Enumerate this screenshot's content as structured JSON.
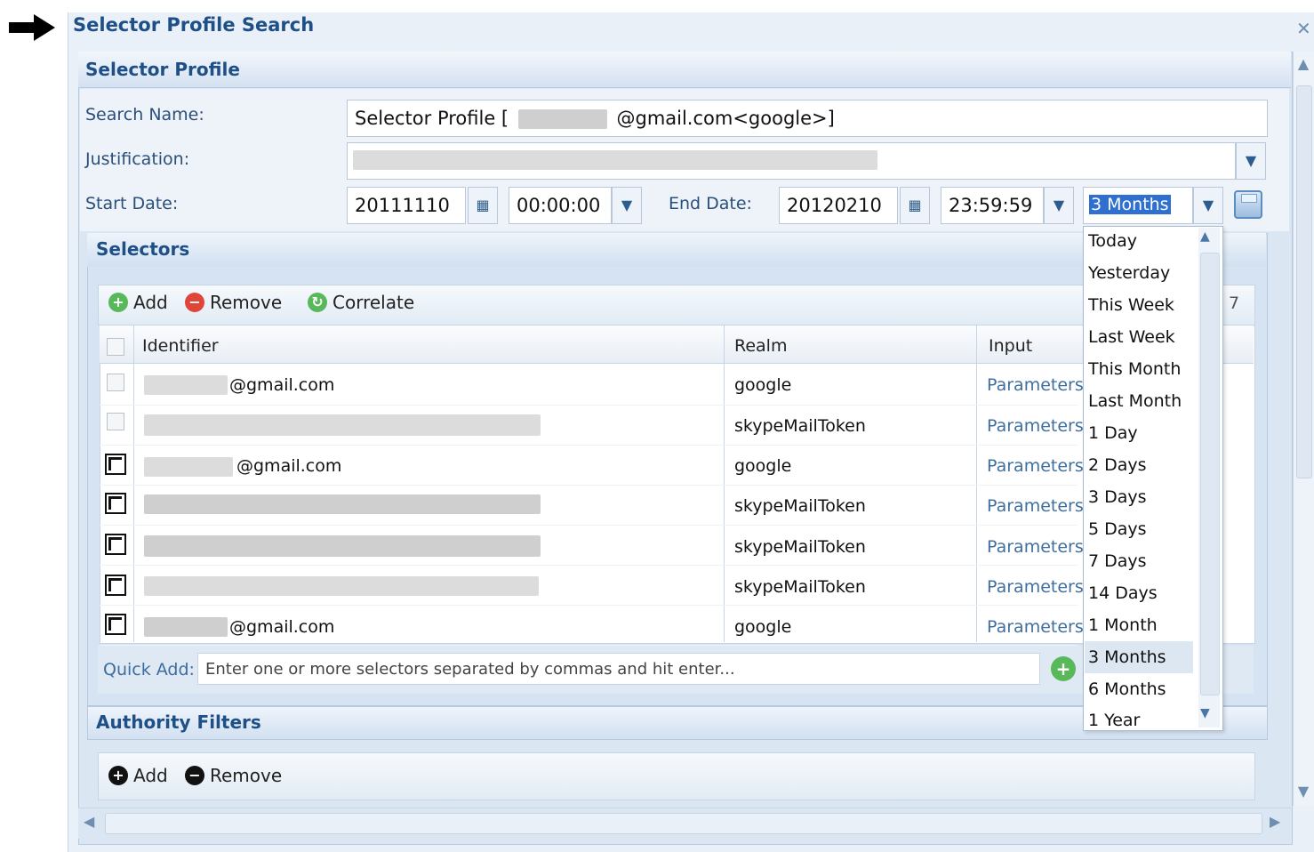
{
  "window": {
    "title": "Selector Profile Search",
    "close_glyph": "✕"
  },
  "panel": {
    "title": "Selector Profile"
  },
  "form": {
    "search_name_label": "Search Name:",
    "search_name_prefix": "Selector Profile [",
    "search_name_suffix": "@gmail.com<google>]",
    "justification_label": "Justification:",
    "start_date_label": "Start Date:",
    "start_date": "20111110",
    "start_time": "00:00:00",
    "end_date_label": "End Date:",
    "end_date": "20120210",
    "end_time": "23:59:59",
    "range_value": "3 Months"
  },
  "selectors": {
    "title": "Selectors",
    "toolbar": {
      "add": "Add",
      "remove": "Remove",
      "correlate": "Correlate",
      "count": "7"
    },
    "columns": {
      "identifier": "Identifier",
      "realm": "Realm",
      "input": "Input"
    },
    "rows": [
      {
        "identifier": "@gmail.com",
        "realm": "google",
        "input": "Parameters",
        "checked": false
      },
      {
        "identifier": "",
        "realm": "skypeMailToken",
        "input": "Parameters",
        "checked": false
      },
      {
        "identifier": "@gmail.com",
        "realm": "google",
        "input": "Parameters",
        "checked": true
      },
      {
        "identifier": "",
        "realm": "skypeMailToken",
        "input": "Parameters",
        "checked": true
      },
      {
        "identifier": "",
        "realm": "skypeMailToken",
        "input": "Parameters",
        "checked": true
      },
      {
        "identifier": "",
        "realm": "skypeMailToken",
        "input": "Parameters",
        "checked": true
      },
      {
        "identifier": "@gmail.com",
        "realm": "google",
        "input": "Parameters",
        "checked": true
      }
    ],
    "quick_add": {
      "label": "Quick Add:",
      "placeholder": "Enter one or more selectors separated by commas and hit enter..."
    }
  },
  "authority_filters": {
    "title": "Authority Filters",
    "toolbar": {
      "add": "Add",
      "remove": "Remove"
    }
  },
  "date_range_options": [
    "Today",
    "Yesterday",
    "This Week",
    "Last Week",
    "This Month",
    "Last Month",
    "1 Day",
    "2 Days",
    "3 Days",
    "5 Days",
    "7 Days",
    "14 Days",
    "1 Month",
    "3 Months",
    "6 Months",
    "1 Year"
  ],
  "date_range_selected": "3 Months",
  "colors": {
    "title_blue": "#1e4f87",
    "panel_bg": "#dbe6f3",
    "param_link": "#3f6f9f",
    "add_green": "#58b85a",
    "remove_red": "#e0453a"
  },
  "icons": [
    "arrow-right-icon",
    "close-icon",
    "chevron-down-icon",
    "calendar-icon",
    "save-icon",
    "add-icon",
    "remove-icon",
    "correlate-icon",
    "scroll-up-icon",
    "scroll-down-icon",
    "scroll-left-icon",
    "scroll-right-icon"
  ]
}
